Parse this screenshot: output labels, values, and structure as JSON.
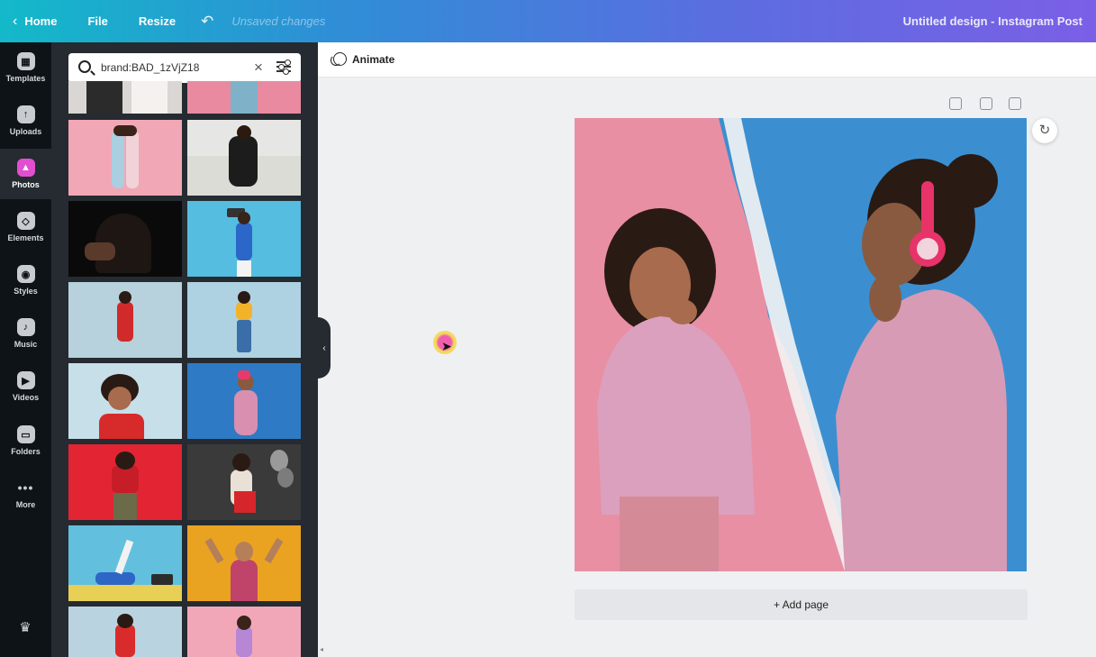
{
  "topbar": {
    "home": "Home",
    "file": "File",
    "resize": "Resize",
    "unsaved": "Unsaved changes",
    "title": "Untitled design - Instagram Post"
  },
  "rail": {
    "items": [
      {
        "label": "Templates",
        "icon": "templates-icon"
      },
      {
        "label": "Uploads",
        "icon": "uploads-icon"
      },
      {
        "label": "Photos",
        "icon": "photos-icon"
      },
      {
        "label": "Elements",
        "icon": "elements-icon"
      },
      {
        "label": "Styles",
        "icon": "styles-icon"
      },
      {
        "label": "Music",
        "icon": "music-icon"
      },
      {
        "label": "Videos",
        "icon": "videos-icon"
      },
      {
        "label": "Folders",
        "icon": "folders-icon"
      },
      {
        "label": "More",
        "icon": "more-icon"
      }
    ],
    "active": "Photos"
  },
  "search": {
    "value": "brand:BAD_1zVjZ18"
  },
  "toolbar": {
    "animate": "Animate"
  },
  "canvas": {
    "add_page": "+ Add page"
  },
  "colors": {
    "accent_pink": "#e14fd0",
    "canvas_pink": "#e88fa4",
    "canvas_blue": "#3b8fd0"
  }
}
